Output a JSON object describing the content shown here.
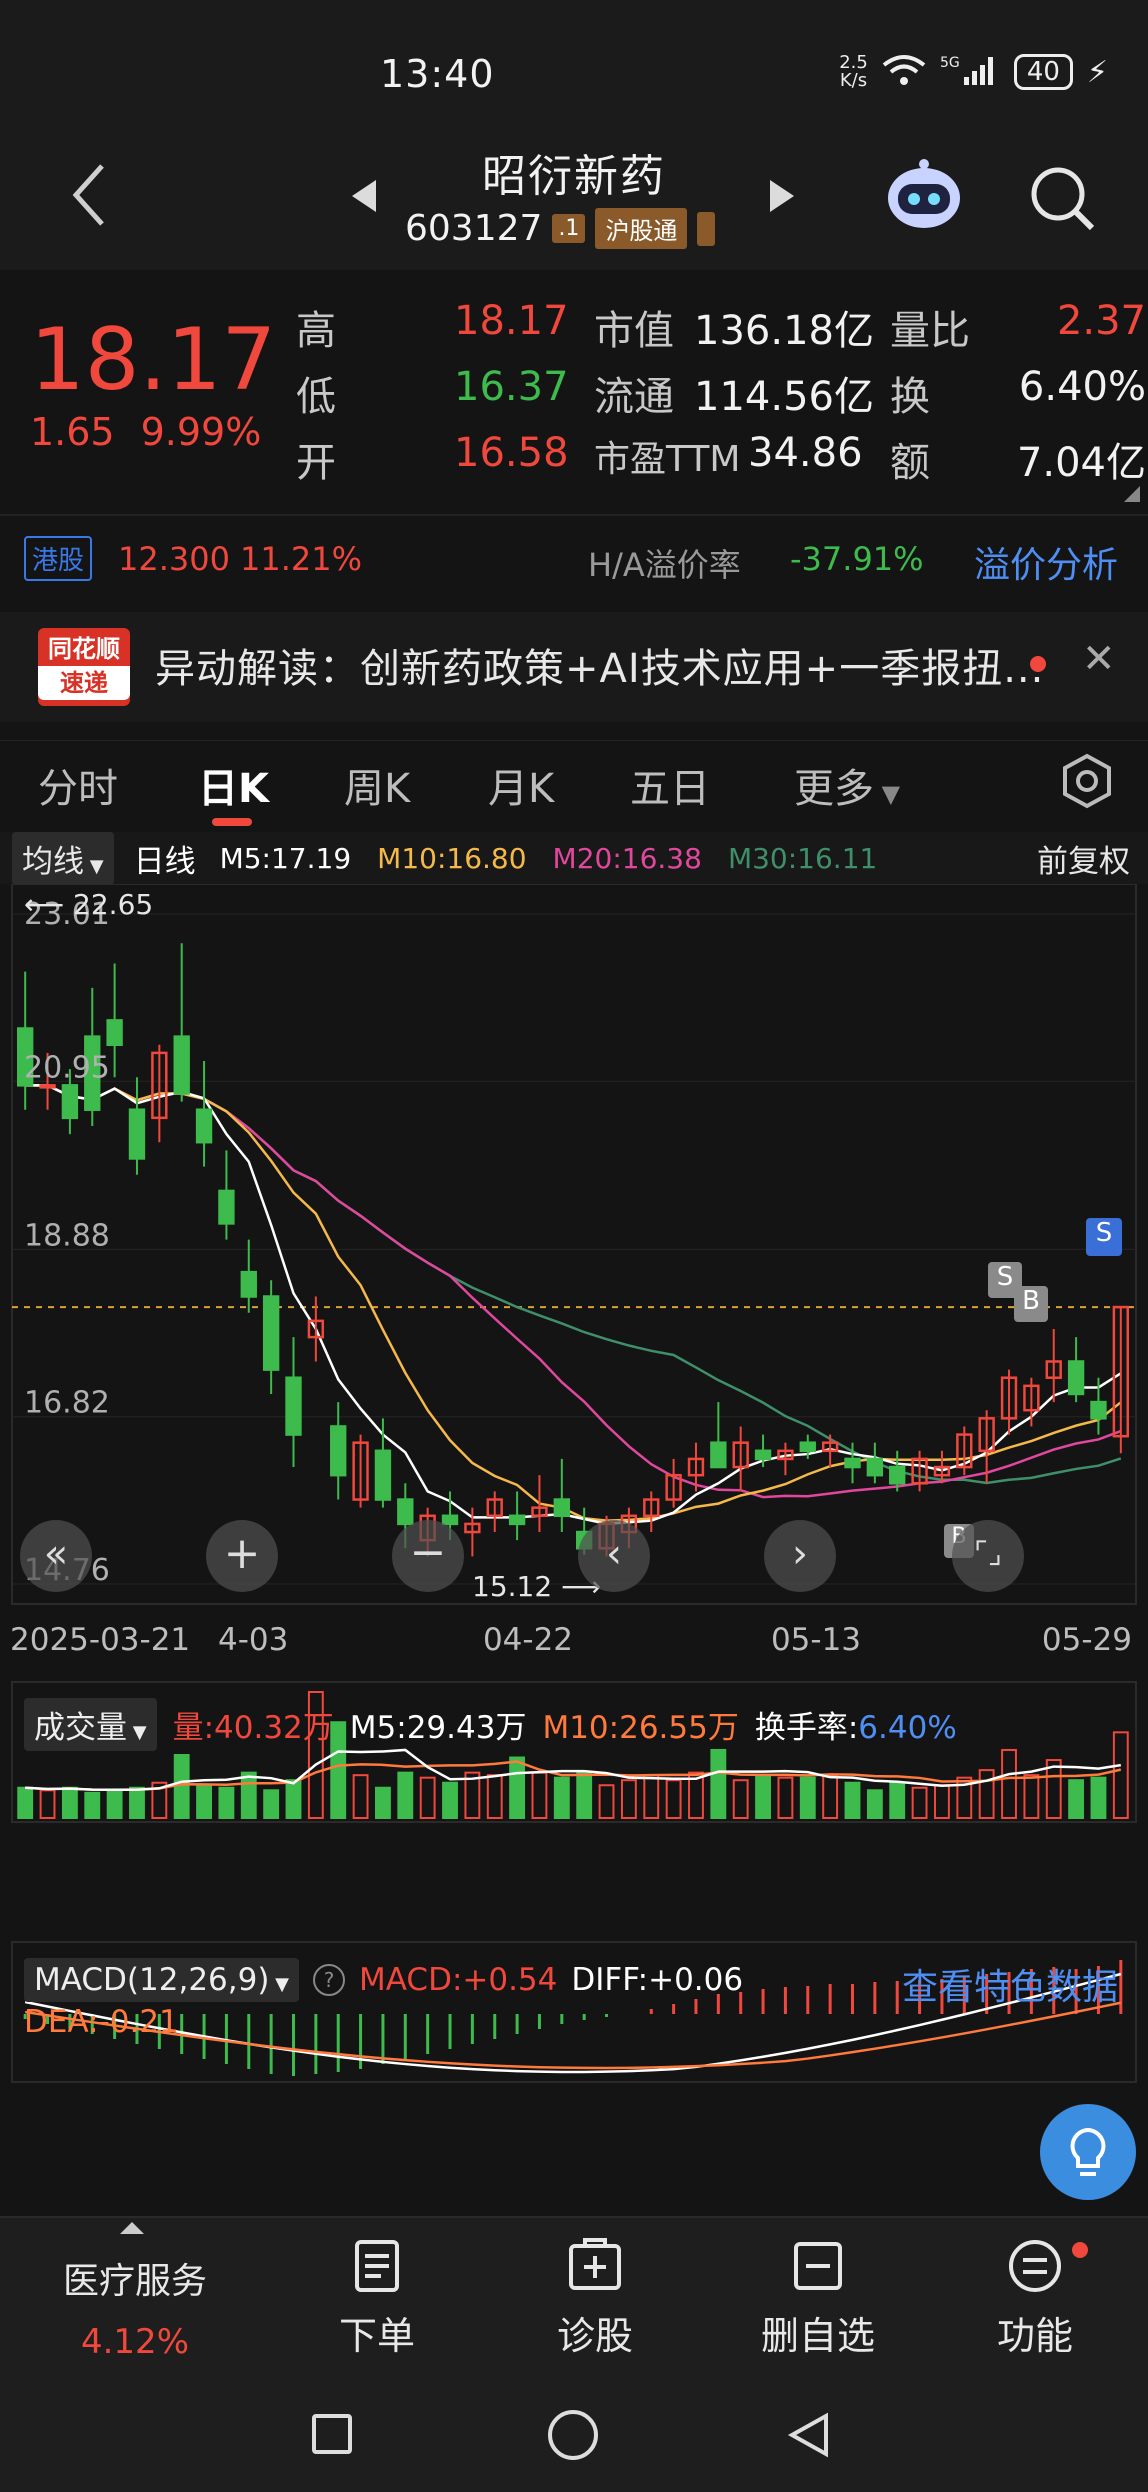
{
  "status": {
    "time": "13:40",
    "speed": "2.5\nK/s",
    "net": "5G",
    "battery": "40"
  },
  "header": {
    "title": "昭衍新药",
    "code": "603127",
    "tag_small": ".1",
    "tag_connect": "沪股通"
  },
  "quote": {
    "price": "18.17",
    "change": "1.65",
    "change_pct": "9.99%",
    "rows": [
      {
        "l1": "高",
        "v1": "18.17",
        "l2": "市值",
        "v2": "136.18亿",
        "l3": "量比",
        "v3": "2.37"
      },
      {
        "l1": "低",
        "v1": "16.37",
        "l2": "流通",
        "v2": "114.56亿",
        "l3": "换",
        "v3": "6.40%"
      },
      {
        "l1": "开",
        "v1": "16.58",
        "l2": "市盈TTM",
        "v2": "34.86",
        "l3": "额",
        "v3": "7.04亿"
      }
    ]
  },
  "hk": {
    "badge": "港股",
    "price": "12.300",
    "pct": "11.21%",
    "premium_label": "H/A溢价率",
    "premium": "-37.91%",
    "link": "溢价分析"
  },
  "news": {
    "logo_top": "同花顺",
    "logo_bottom": "速递",
    "text": "异动解读：创新药政策+AI技术应用+一季报扭..."
  },
  "tabs": [
    "分时",
    "日K",
    "周K",
    "月K",
    "五日",
    "更多"
  ],
  "ma_legend": {
    "dropdown": "均线",
    "period": "日线",
    "m5": "M5:17.19",
    "m10": "M10:16.80",
    "m20": "M20:16.38",
    "m30": "M30:16.11",
    "adjust": "前复权"
  },
  "colors": {
    "up": "#f0483c",
    "down": "#3dbb4c",
    "m5": "#ffffff",
    "m10": "#f5b94a",
    "m20": "#e0489e",
    "m30": "#3f8f6a",
    "accent": "#4f8ef2"
  },
  "chart_data": [
    {
      "type": "candlestick",
      "title": "",
      "y_ticks": [
        "23.01",
        "20.95",
        "18.88",
        "16.82",
        "14.76"
      ],
      "ylim": [
        14.76,
        23.01
      ],
      "x_ticks": [
        "2025-03-21",
        "4-03",
        "04-22",
        "05-13",
        "05-29"
      ],
      "annotations": {
        "high": "22.65",
        "low": "15.12",
        "markers": [
          "S",
          "B",
          "S",
          "B"
        ]
      },
      "candles": [
        [
          21.6,
          22.3,
          20.6,
          20.9
        ],
        [
          20.9,
          21.3,
          20.6,
          20.9
        ],
        [
          20.9,
          21.1,
          20.3,
          20.5
        ],
        [
          21.5,
          22.1,
          20.4,
          20.6
        ],
        [
          21.7,
          22.4,
          21.0,
          21.4
        ],
        [
          20.6,
          21.0,
          19.8,
          20.0
        ],
        [
          20.5,
          21.4,
          20.2,
          21.3
        ],
        [
          21.5,
          22.65,
          20.7,
          20.8
        ],
        [
          20.6,
          21.2,
          19.9,
          20.2
        ],
        [
          19.6,
          20.1,
          19.0,
          19.2
        ],
        [
          18.6,
          19.0,
          18.1,
          18.3
        ],
        [
          18.3,
          18.5,
          17.1,
          17.4
        ],
        [
          17.3,
          17.8,
          16.2,
          16.6
        ],
        [
          17.8,
          18.3,
          17.5,
          18.0
        ],
        [
          16.7,
          17.0,
          15.8,
          16.1
        ],
        [
          15.8,
          16.6,
          15.7,
          16.5
        ],
        [
          16.4,
          16.8,
          15.7,
          15.8
        ],
        [
          15.8,
          16.0,
          15.2,
          15.5
        ],
        [
          15.3,
          15.7,
          15.1,
          15.6
        ],
        [
          15.6,
          15.9,
          15.3,
          15.5
        ],
        [
          15.4,
          15.7,
          15.1,
          15.5
        ],
        [
          15.6,
          15.9,
          15.4,
          15.8
        ],
        [
          15.6,
          15.9,
          15.3,
          15.5
        ],
        [
          15.6,
          16.1,
          15.4,
          15.7
        ],
        [
          15.8,
          16.3,
          15.4,
          15.6
        ],
        [
          15.4,
          15.7,
          15.12,
          15.2
        ],
        [
          15.2,
          15.6,
          15.1,
          15.5
        ],
        [
          15.4,
          15.7,
          15.2,
          15.6
        ],
        [
          15.6,
          15.9,
          15.4,
          15.8
        ],
        [
          15.8,
          16.3,
          15.7,
          16.1
        ],
        [
          16.1,
          16.5,
          15.9,
          16.3
        ],
        [
          16.5,
          17.0,
          16.4,
          16.2
        ],
        [
          16.2,
          16.7,
          15.9,
          16.5
        ],
        [
          16.4,
          16.6,
          16.2,
          16.3
        ],
        [
          16.3,
          16.5,
          16.1,
          16.4
        ],
        [
          16.5,
          16.6,
          16.3,
          16.4
        ],
        [
          16.4,
          16.6,
          16.2,
          16.5
        ],
        [
          16.3,
          16.5,
          16.0,
          16.2
        ],
        [
          16.3,
          16.5,
          16.0,
          16.1
        ],
        [
          16.2,
          16.4,
          15.9,
          16.0
        ],
        [
          16.0,
          16.4,
          15.9,
          16.3
        ],
        [
          16.1,
          16.4,
          16.0,
          16.2
        ],
        [
          16.2,
          16.7,
          16.1,
          16.6
        ],
        [
          16.4,
          16.9,
          16.0,
          16.8
        ],
        [
          16.8,
          17.4,
          16.6,
          17.3
        ],
        [
          16.9,
          17.3,
          16.7,
          17.2
        ],
        [
          17.3,
          17.9,
          17.0,
          17.5
        ],
        [
          17.5,
          17.8,
          17.0,
          17.1
        ],
        [
          17.0,
          17.3,
          16.6,
          16.8
        ],
        [
          16.58,
          18.17,
          16.37,
          18.17
        ]
      ]
    },
    {
      "type": "bar",
      "title": "成交量",
      "legend": {
        "dropdown": "成交量",
        "vol": "量:40.32万",
        "m5": "M5:29.43万",
        "m10": "M10:26.55万",
        "turnover_label": "换手率:",
        "turnover": "6.40%"
      },
      "values": [
        12,
        11,
        12,
        10,
        11,
        12,
        14,
        25,
        13,
        12,
        18,
        11,
        15,
        50,
        38,
        17,
        12,
        18,
        16,
        14,
        18,
        17,
        24,
        18,
        16,
        18,
        13,
        15,
        17,
        15,
        18,
        27,
        15,
        17,
        16,
        16,
        17,
        14,
        11,
        14,
        12,
        13,
        16,
        19,
        27,
        17,
        23,
        15,
        16,
        34
      ]
    },
    {
      "type": "bar",
      "title": "MACD",
      "legend": {
        "dropdown": "MACD(12,26,9)",
        "macd": "MACD:+0.54",
        "diff": "DIFF:+0.06",
        "dea": "DEA:-0.21",
        "link": "查看特色数据"
      },
      "values": [
        -0.05,
        -0.1,
        -0.15,
        -0.2,
        -0.25,
        -0.3,
        -0.35,
        -0.4,
        -0.45,
        -0.5,
        -0.55,
        -0.6,
        -0.62,
        -0.6,
        -0.58,
        -0.55,
        -0.5,
        -0.45,
        -0.4,
        -0.35,
        -0.3,
        -0.25,
        -0.2,
        -0.15,
        -0.1,
        -0.06,
        -0.03,
        0.0,
        0.05,
        0.1,
        0.15,
        0.2,
        0.22,
        0.25,
        0.27,
        0.28,
        0.3,
        0.3,
        0.32,
        0.33,
        0.34,
        0.35,
        0.37,
        0.4,
        0.42,
        0.45,
        0.47,
        0.45,
        0.48,
        0.54
      ]
    }
  ],
  "bottom": {
    "sector": "医疗服务",
    "sector_pct": "4.12%",
    "order": "下单",
    "diagnose": "诊股",
    "remove": "删自选",
    "functions": "功能"
  }
}
